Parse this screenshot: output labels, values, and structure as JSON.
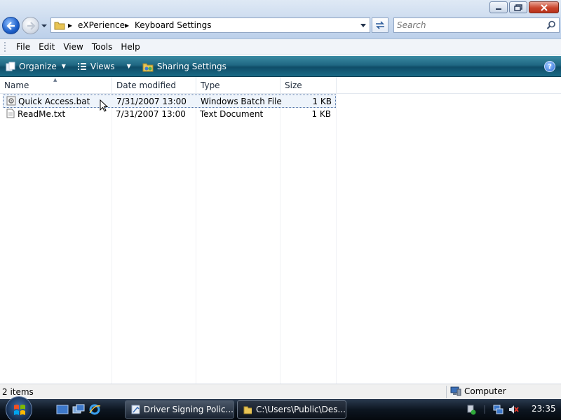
{
  "window": {
    "address_path": [
      "eXPerience",
      "Keyboard Settings"
    ],
    "search_placeholder": "Search"
  },
  "menu": [
    "File",
    "Edit",
    "View",
    "Tools",
    "Help"
  ],
  "commands": {
    "organize": "Organize",
    "views": "Views",
    "sharing": "Sharing Settings"
  },
  "columns": {
    "name": "Name",
    "date": "Date modified",
    "type": "Type",
    "size": "Size"
  },
  "files": [
    {
      "name": "Quick Access.bat",
      "date": "7/31/2007 13:00",
      "type": "Windows Batch File",
      "size": "1 KB",
      "selected": true
    },
    {
      "name": "ReadMe.txt",
      "date": "7/31/2007 13:00",
      "type": "Text Document",
      "size": "1 KB",
      "selected": false
    }
  ],
  "status": {
    "count": "2 items",
    "location": "Computer"
  },
  "taskbar": {
    "tasks": [
      "Driver Signing Polic...",
      "C:\\Users\\Public\\Des..."
    ],
    "time": "23:35"
  }
}
